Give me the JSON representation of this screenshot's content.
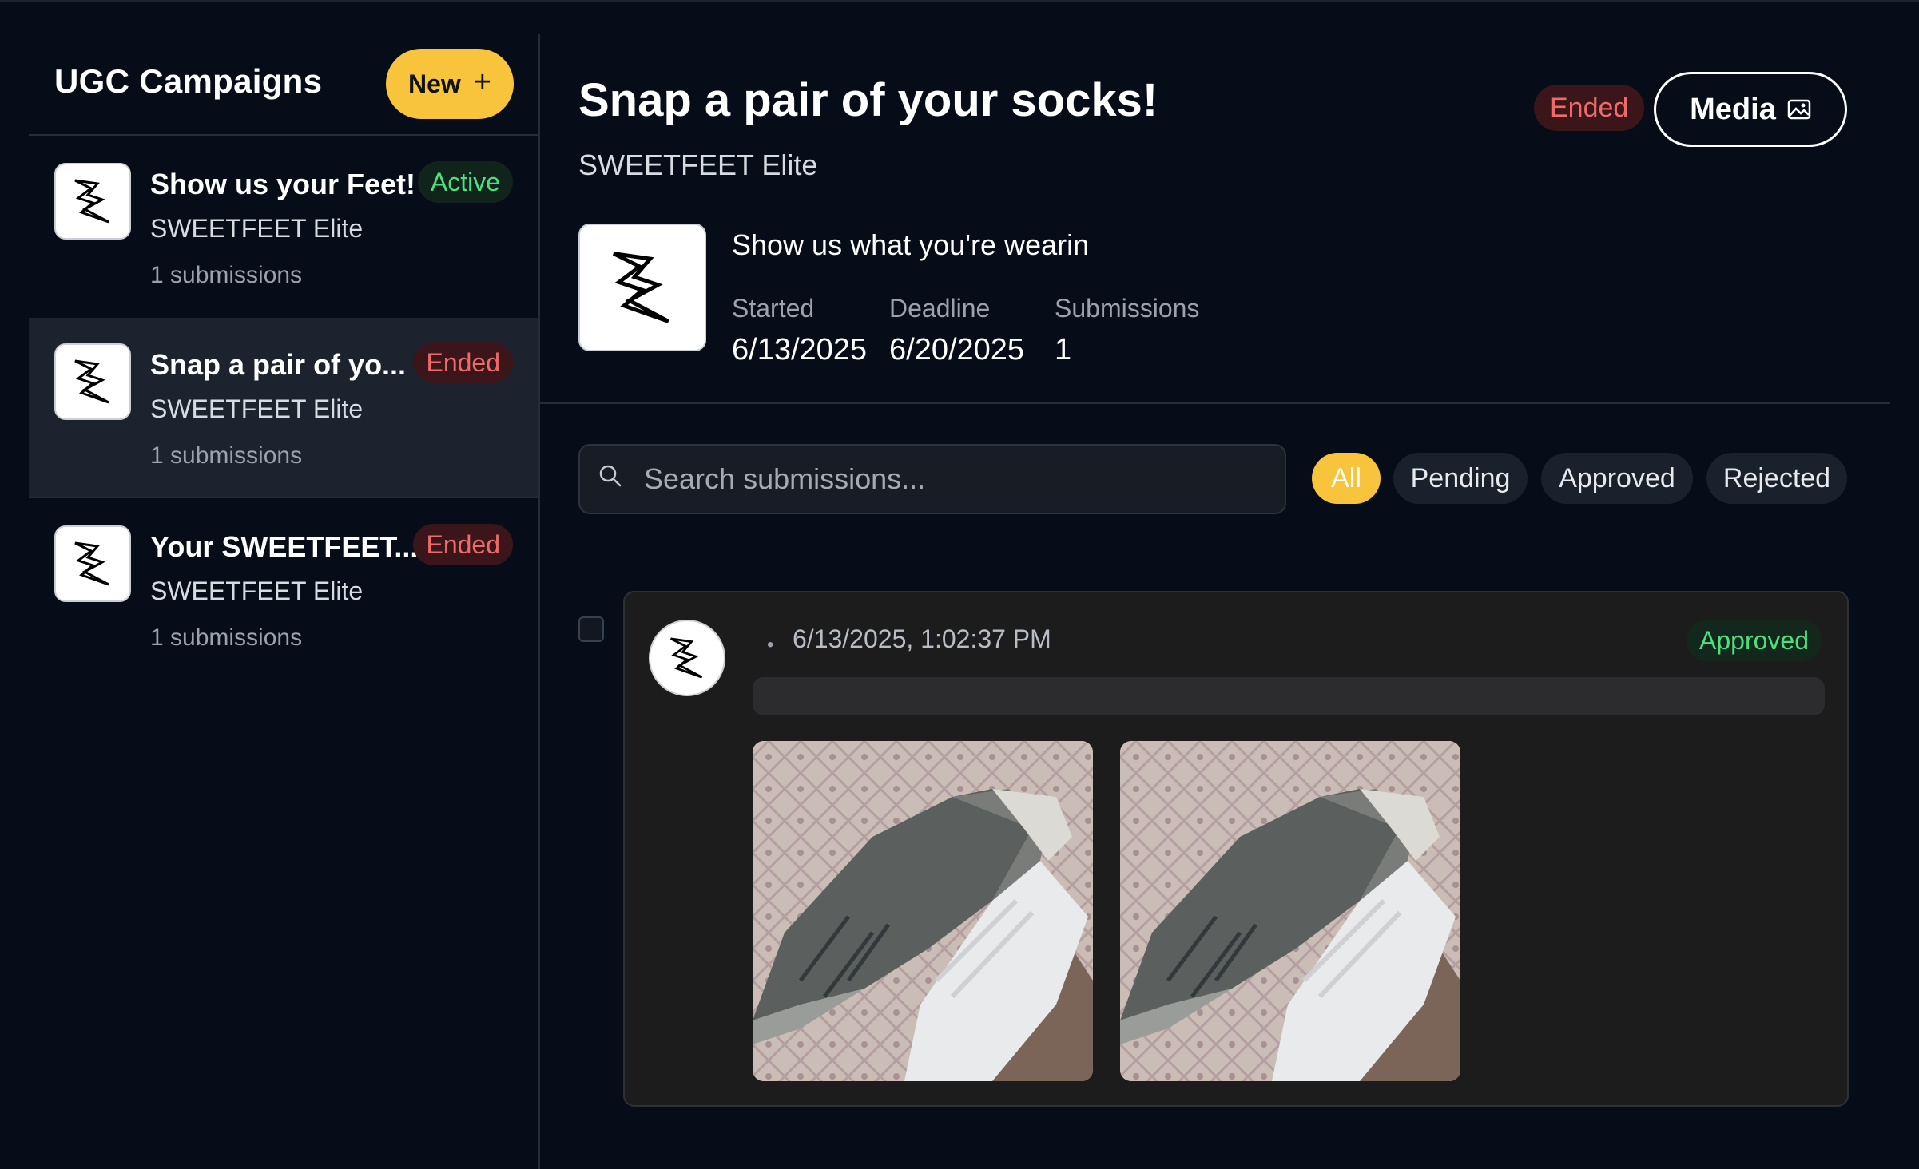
{
  "sidebar": {
    "title": "UGC Campaigns",
    "new_label": "New",
    "items": [
      {
        "name": "Show us your Feet!",
        "brand": "SWEETFEET Elite",
        "submissions": "1 submissions",
        "status": "Active"
      },
      {
        "name": "Snap a pair of yo...",
        "brand": "SWEETFEET Elite",
        "submissions": "1 submissions",
        "status": "Ended"
      },
      {
        "name": "Your SWEETFEET...",
        "brand": "SWEETFEET Elite",
        "submissions": "1 submissions",
        "status": "Ended"
      }
    ]
  },
  "campaign": {
    "title": "Snap a pair of your socks!",
    "brand": "SWEETFEET Elite",
    "status": "Ended",
    "media_label": "Media",
    "description": "Show us what you're wearin",
    "stats": {
      "started_label": "Started",
      "started_value": "6/13/2025",
      "deadline_label": "Deadline",
      "deadline_value": "6/20/2025",
      "submissions_label": "Submissions",
      "submissions_value": "1"
    }
  },
  "search": {
    "placeholder": "Search submissions..."
  },
  "filters": [
    "All",
    "Pending",
    "Approved",
    "Rejected"
  ],
  "submission": {
    "timestamp": "6/13/2025, 1:02:37 PM",
    "dot": "•",
    "status": "Approved"
  },
  "colors": {
    "accent": "#f8c43c",
    "active": "#4ee07e",
    "ended": "#f06a6a",
    "background": "#070d18"
  }
}
